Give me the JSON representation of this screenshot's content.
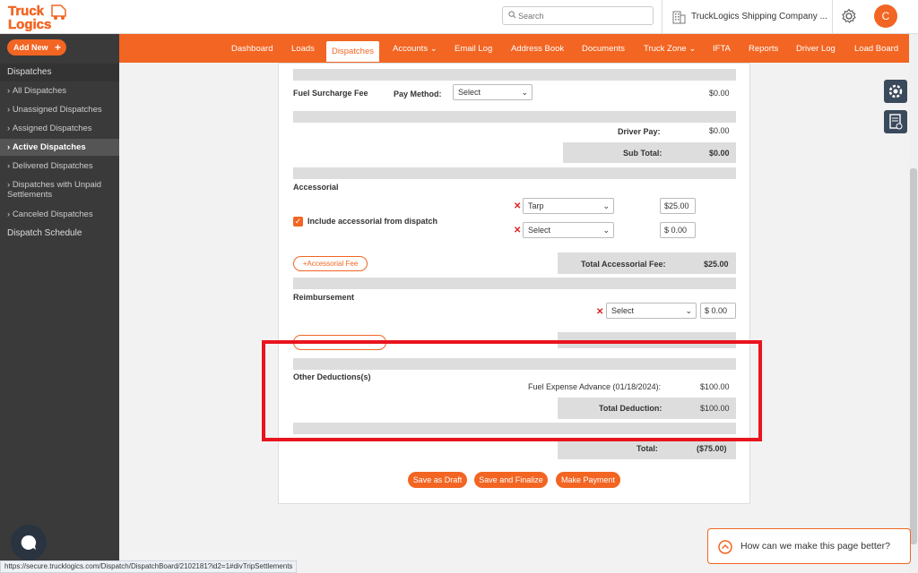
{
  "header": {
    "logo_line1": "Truck",
    "logo_line2": "Logics",
    "search_placeholder": "Search",
    "company": "TruckLogics Shipping Company ...",
    "avatar_initial": "C"
  },
  "sidebar": {
    "add_new": "Add New",
    "section": "Dispatches",
    "items": [
      {
        "label": "All Dispatches"
      },
      {
        "label": "Unassigned Dispatches"
      },
      {
        "label": "Assigned Dispatches"
      },
      {
        "label": "Active Dispatches"
      },
      {
        "label": "Delivered Dispatches"
      },
      {
        "label": "Dispatches with Unpaid Settlements"
      },
      {
        "label": "Canceled Dispatches"
      }
    ],
    "schedule": "Dispatch Schedule"
  },
  "nav": {
    "items": [
      "Dashboard",
      "Loads",
      "Dispatches",
      "Accounts",
      "Email Log",
      "Address Book",
      "Documents",
      "Truck Zone",
      "IFTA",
      "Reports",
      "Driver Log",
      "Load Board"
    ]
  },
  "form": {
    "fuel_surcharge_label": "Fuel Surcharge Fee",
    "pay_method_label": "Pay Method:",
    "pay_method_value": "Select",
    "fuel_surcharge_amount": "$0.00",
    "driver_pay_label": "Driver Pay:",
    "driver_pay_value": "$0.00",
    "sub_total_label": "Sub Total:",
    "sub_total_value": "$0.00",
    "accessorial_label": "Accessorial",
    "include_accessorial_label": "Include accessorial from dispatch",
    "acc_row1_select": "Tarp",
    "acc_row1_amount": "25.00",
    "acc_row2_select": "Select",
    "acc_row2_amount": "0.00",
    "currency_symbol": "$",
    "add_accessorial_btn": "Accessorial Fee",
    "total_accessorial_label": "Total Accessorial Fee:",
    "total_accessorial_value": "$25.00",
    "reimbursement_label": "Reimbursement",
    "reimb_select": "Select",
    "reimb_amount": "0.00",
    "other_deductions_label": "Other Deductions(s)",
    "fuel_advance_label": "Fuel Expense Advance (01/18/2024):",
    "fuel_advance_value": "$100.00",
    "total_deduction_label": "Total Deduction:",
    "total_deduction_value": "$100.00",
    "total_label": "Total:",
    "total_value": "($75.00)",
    "save_draft": "Save as Draft",
    "save_finalize": "Save and Finalize",
    "make_payment": "Make Payment"
  },
  "help": {
    "text": "How can we make this page better?"
  },
  "status_url": "https://secure.trucklogics.com/Dispatch/DispatchBoard/2102181?id2=1#divTripSettlements",
  "colors": {
    "brand": "#f26522",
    "sidebar": "#3a3a3a",
    "highlight": "#e8141e"
  }
}
